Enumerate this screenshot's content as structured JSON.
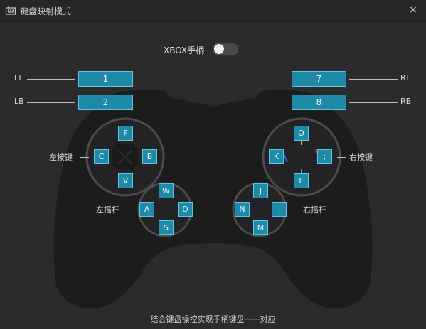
{
  "window": {
    "title": "键盘映射模式",
    "close_symbol": "×"
  },
  "xbox_toggle": {
    "label": "XBOX手柄",
    "on": false
  },
  "triggers": {
    "LT": {
      "label": "LT",
      "key": "1"
    },
    "LB": {
      "label": "LB",
      "key": "2"
    },
    "RT": {
      "label": "RT",
      "key": "7"
    },
    "RB": {
      "label": "RB",
      "key": "8"
    }
  },
  "left_buttons": {
    "label": "左按键",
    "up": "F",
    "left": "C",
    "right": "B",
    "down": "V"
  },
  "right_buttons": {
    "label": "右按键",
    "up": "O",
    "left": "K",
    "right": ";",
    "down": "L"
  },
  "left_stick": {
    "label": "左摇杆",
    "up": "W",
    "left": "A",
    "right": "D",
    "down": "S"
  },
  "right_stick": {
    "label": "右摇杆",
    "up": "J",
    "left": "N",
    "right": ",",
    "down": "M"
  },
  "footer": {
    "text": "结合键盘操控实现手柄键盘——对应"
  },
  "colors": {
    "key_fill": "#1f8aa8",
    "key_border": "#5fc4dc",
    "background": "#2b2b2d",
    "controller": "#1c1c1d"
  }
}
